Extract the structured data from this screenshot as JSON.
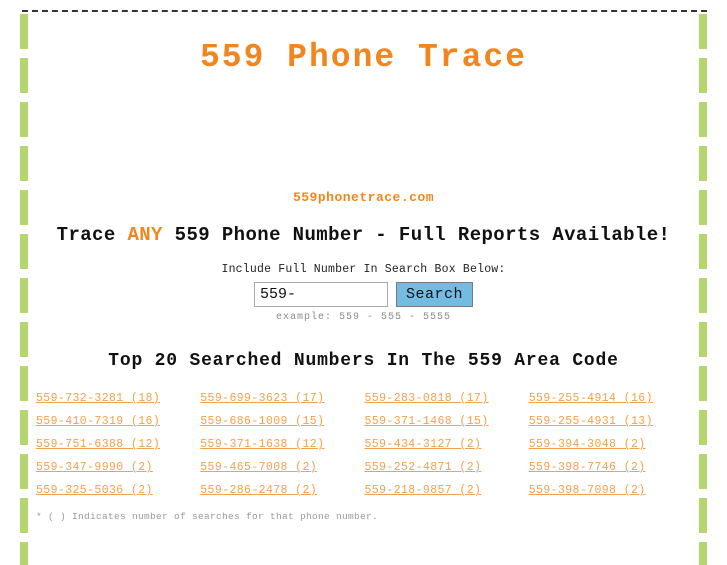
{
  "site": {
    "title": "559 Phone Trace",
    "domain": "559phonetrace.com",
    "tagline_before": "Trace ",
    "tagline_highlight": "ANY",
    "tagline_after": " 559 Phone Number - Full Reports Available!"
  },
  "search": {
    "instruction": "Include Full Number In Search Box Below:",
    "value": "559-",
    "placeholder": "559-",
    "button_label": "Search",
    "example": "example: 559 - 555 - 5555"
  },
  "top_numbers": {
    "heading": "Top 20 Searched Numbers In The 559 Area Code",
    "footnote": "* ( ) Indicates number of searches for that phone number.",
    "items": [
      {
        "number": "559-732-3281",
        "count": "(18)",
        "label": "559-732-3281 (18)"
      },
      {
        "number": "559-699-3623",
        "count": "(17)",
        "label": "559-699-3623 (17)"
      },
      {
        "number": "559-283-0818",
        "count": "(17)",
        "label": "559-283-0818 (17)"
      },
      {
        "number": "559-255-4914",
        "count": "(16)",
        "label": "559-255-4914 (16)"
      },
      {
        "number": "559-410-7319",
        "count": "(16)",
        "label": "559-410-7319 (16)"
      },
      {
        "number": "559-686-1009",
        "count": "(15)",
        "label": "559-686-1009 (15)"
      },
      {
        "number": "559-371-1468",
        "count": "(15)",
        "label": "559-371-1468 (15)"
      },
      {
        "number": "559-255-4931",
        "count": "(13)",
        "label": "559-255-4931 (13)"
      },
      {
        "number": "559-751-6388",
        "count": "(12)",
        "label": "559-751-6388 (12)"
      },
      {
        "number": "559-371-1638",
        "count": "(12)",
        "label": "559-371-1638 (12)"
      },
      {
        "number": "559-434-3127",
        "count": "(2)",
        "label": "559-434-3127 (2)"
      },
      {
        "number": "559-394-3048",
        "count": "(2)",
        "label": "559-394-3048 (2)"
      },
      {
        "number": "559-347-9990",
        "count": "(2)",
        "label": "559-347-9990 (2)"
      },
      {
        "number": "559-465-7008",
        "count": "(2)",
        "label": "559-465-7008 (2)"
      },
      {
        "number": "559-252-4871",
        "count": "(2)",
        "label": "559-252-4871 (2)"
      },
      {
        "number": "559-398-7746",
        "count": "(2)",
        "label": "559-398-7746 (2)"
      },
      {
        "number": "559-325-5036",
        "count": "(2)",
        "label": "559-325-5036 (2)"
      },
      {
        "number": "559-286-2478",
        "count": "(2)",
        "label": "559-286-2478 (2)"
      },
      {
        "number": "559-218-9857",
        "count": "(2)",
        "label": "559-218-9857 (2)"
      },
      {
        "number": "559-398-7098",
        "count": "(2)",
        "label": "559-398-7098 (2)"
      }
    ]
  },
  "colors": {
    "accent_orange": "#f2861e",
    "link_orange": "#f7a04a",
    "frame_green": "#b5d66e",
    "button_blue": "#74bbe2"
  }
}
